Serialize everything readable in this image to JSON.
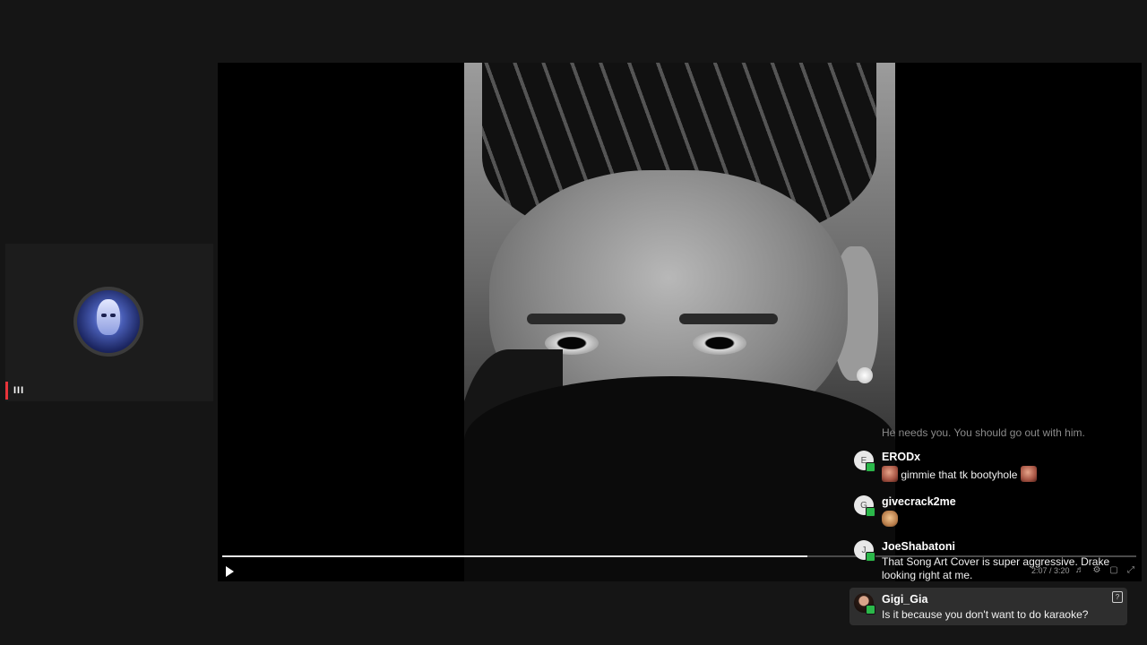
{
  "participant": {
    "avatar_icon": "masked-face-avatar",
    "mic_glyph": "III"
  },
  "player": {
    "time": "2:07 / 3:20",
    "progress_fraction": 0.64,
    "controls": [
      "volume-icon",
      "settings-icon",
      "pip-icon",
      "fullscreen-icon"
    ]
  },
  "chat": {
    "faded_message": "He needs you. You should go out with him.",
    "messages": [
      {
        "initial": "E",
        "name": "ERODx",
        "text": "gimmie that tk bootyhole",
        "emotes": [
          "face-emote",
          "face-emote"
        ]
      },
      {
        "initial": "G",
        "name": "givecrack2me",
        "text": "",
        "emotes": [
          "hand-emote"
        ]
      },
      {
        "initial": "J",
        "name": "JoeShabatoni",
        "text": "That Song Art Cover is super aggressive. Drake looking right at me."
      },
      {
        "initial": "",
        "name": "Gigi_Gia",
        "text": "Is it because you don't want to do karaoke?"
      }
    ],
    "report_glyph": "?"
  }
}
